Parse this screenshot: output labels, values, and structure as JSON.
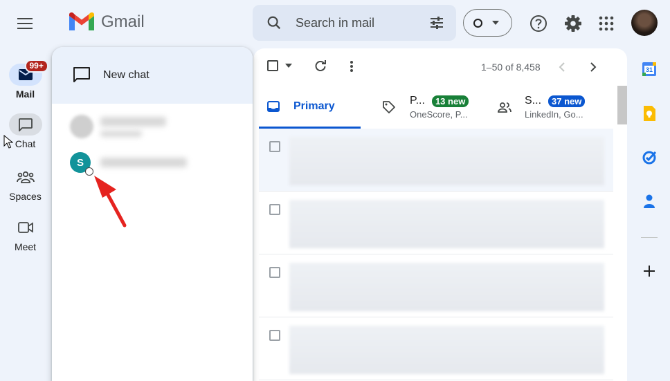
{
  "header": {
    "app_name": "Gmail",
    "search_placeholder": "Search in mail"
  },
  "rail": {
    "mail_label": "Mail",
    "mail_badge": "99+",
    "chat_label": "Chat",
    "spaces_label": "Spaces",
    "meet_label": "Meet"
  },
  "chat_panel": {
    "new_chat_label": "New chat",
    "contact_initial": "S"
  },
  "toolbar": {
    "pagination": "1–50 of 8,458"
  },
  "tabs": {
    "primary_label": "Primary",
    "promotions_label": "P...",
    "promotions_badge": "13 new",
    "promotions_sub": "OneScore, P...",
    "social_label": "S...",
    "social_badge": "37 new",
    "social_sub": "LinkedIn, Go..."
  },
  "side_panel": {
    "calendar_day": "31"
  },
  "colors": {
    "promotions_badge": "#188038",
    "social_badge": "#0b57d0",
    "accent": "#0b57d0",
    "arrow": "#e5231f"
  }
}
